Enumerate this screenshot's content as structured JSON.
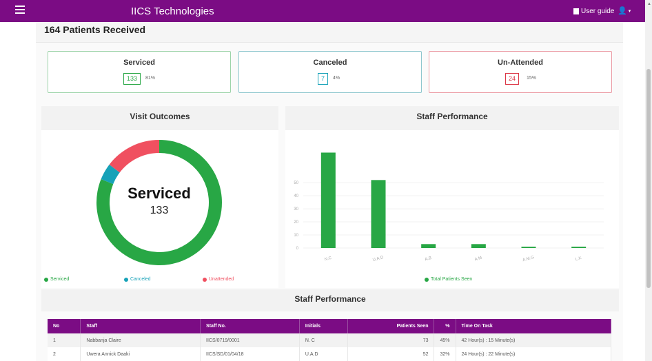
{
  "app": {
    "title": "IICS Technologies",
    "user_guide": "User guide",
    "accent_color": "#7b0c84"
  },
  "received": "164 Patients Received",
  "summary": [
    {
      "title": "Serviced",
      "count": "133",
      "percent": "81%",
      "color": "#28a745"
    },
    {
      "title": "Canceled",
      "count": "7",
      "percent": "4%",
      "color": "#17a2b8"
    },
    {
      "title": "Un-Attended",
      "count": "24",
      "percent": "15%",
      "color": "#dc3545"
    }
  ],
  "visit_outcomes": {
    "title": "Visit Outcomes",
    "center_label": "Serviced",
    "center_value": "133",
    "legend": [
      "Serviced",
      "Canceled",
      "Unattended"
    ]
  },
  "staff_chart": {
    "title": "Staff Performance",
    "legend": "Total Patients Seen"
  },
  "table_section_title": "Staff Performance",
  "table": {
    "headers": [
      "No",
      "Staff",
      "Staff No.",
      "Initials",
      "Patients Seen",
      "%",
      "Time On Task"
    ],
    "rows": [
      [
        "1",
        "Nabbanja Claire",
        "IICS/0719/0001",
        "N. C",
        "73",
        "45%",
        "42 Hour(s) : 15 Minute(s)"
      ],
      [
        "2",
        "Uwera Annick Daaki",
        "IICS/SD/01/04/18",
        "U.A.D",
        "52",
        "32%",
        "24 Hour(s) : 22 Minute(s)"
      ]
    ]
  },
  "chart_data": [
    {
      "type": "pie",
      "title": "Visit Outcomes",
      "labels": [
        "Serviced",
        "Canceled",
        "Unattended"
      ],
      "values": [
        133,
        7,
        24
      ],
      "colors": [
        "#28a745",
        "#17a2b8",
        "#f05060"
      ]
    },
    {
      "type": "bar",
      "title": "Staff Performance",
      "categories": [
        "N.C",
        "U.A.D",
        "A.B",
        "A.M",
        "A.M.G",
        "L.K"
      ],
      "series": [
        {
          "name": "Total Patients Seen",
          "values": [
            73,
            52,
            3,
            3,
            1,
            1
          ]
        }
      ],
      "y_ticks": [
        "0",
        "10",
        "20",
        "30",
        "40",
        "50"
      ],
      "ylim": [
        0,
        78
      ],
      "color": "#28a745"
    }
  ]
}
